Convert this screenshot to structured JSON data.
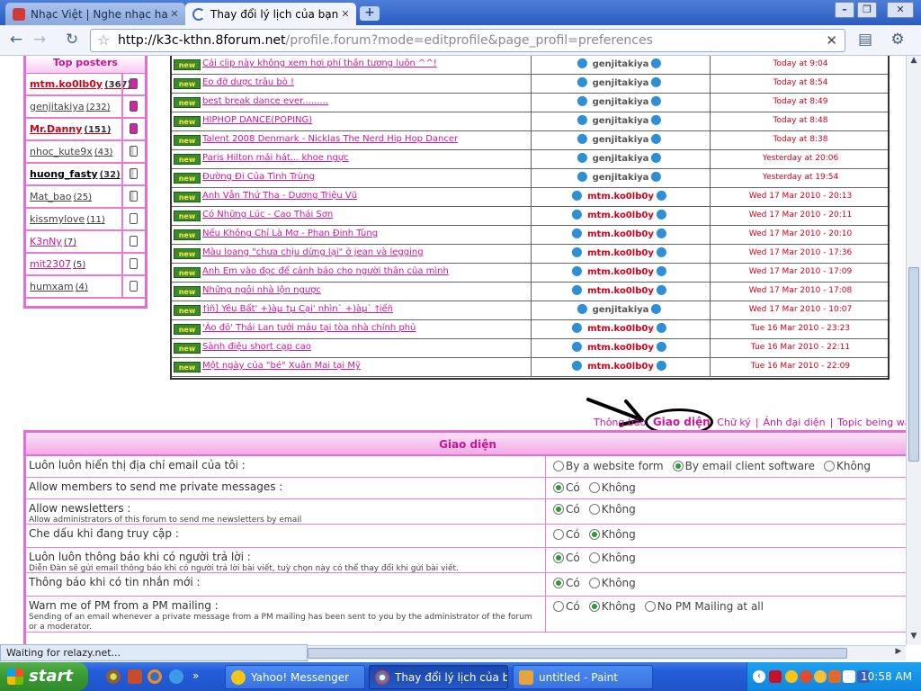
{
  "browser": {
    "tabs": [
      {
        "label": "Nhạc Việt | Nghe nhạc hay ...",
        "active": false
      },
      {
        "label": "Thay đổi lý lịch của bạn",
        "active": true
      }
    ],
    "url_host": "http://k3c-kthn.8forum.net",
    "url_path": "/profile.forum?mode=editprofile&page_profil=preferences",
    "status_text": "Waiting for relazy.net..."
  },
  "top_posters": {
    "title": "Top posters",
    "rows": [
      {
        "name": "mtm.ko0lb0y",
        "count": "(367)",
        "color": "#d4001a",
        "bold": true,
        "bar": "full"
      },
      {
        "name": "genjitakiya",
        "count": "(232)",
        "color": "#444444",
        "bold": false,
        "bar": "full"
      },
      {
        "name": "Mr.Danny",
        "count": "(151)",
        "color": "#d4001a",
        "bold": true,
        "bar": "full"
      },
      {
        "name": "nhoc_kute9x",
        "count": "(43)",
        "color": "#444444",
        "bold": false,
        "bar": "half"
      },
      {
        "name": "huong_fasty",
        "count": "(32)",
        "color": "#000000",
        "bold": true,
        "bar": "half"
      },
      {
        "name": "Mat_bao",
        "count": "(25)",
        "color": "#444444",
        "bold": false,
        "bar": "half"
      },
      {
        "name": "kissmylove",
        "count": "(11)",
        "color": "#444444",
        "bold": false,
        "bar": "empty"
      },
      {
        "name": "K3nNy",
        "count": "(7)",
        "color": "#d0169a",
        "bold": false,
        "bar": "empty"
      },
      {
        "name": "mit2307",
        "count": "(5)",
        "color": "#d0169a",
        "bold": false,
        "bar": "empty"
      },
      {
        "name": "humxam",
        "count": "(4)",
        "color": "#444444",
        "bold": false,
        "bar": "empty"
      }
    ]
  },
  "topics": [
    {
      "title": "Cái clip này không xem hơi phí thần tương luôn ^^!",
      "author": "genjitakiya",
      "author_style": "grey",
      "date": "Today at 9:04"
    },
    {
      "title": "Eo đỡ dược trâu bò !",
      "author": "genjitakiya",
      "author_style": "grey",
      "date": "Today at 8:54"
    },
    {
      "title": "best break dance ever.........",
      "author": "genjitakiya",
      "author_style": "grey",
      "date": "Today at 8:49"
    },
    {
      "title": "HIPHOP DANCE(POPING)",
      "author": "genjitakiya",
      "author_style": "grey",
      "date": "Today at 8:48"
    },
    {
      "title": "Talent 2008 Denmark - Nicklas The Nerd Hip Hop Dancer",
      "author": "genjitakiya",
      "author_style": "grey",
      "date": "Today at 8:38"
    },
    {
      "title": "Paris Hilton mải hát... khoe ngực",
      "author": "genjitakiya",
      "author_style": "grey",
      "date": "Yesterday at 20:06"
    },
    {
      "title": "Đường Đi Của Tình Trùng",
      "author": "genjitakiya",
      "author_style": "grey",
      "date": "Yesterday at 19:54"
    },
    {
      "title": "Anh Vẫn Thứ Tha - Dương Triệu Vũ",
      "author": "mtm.ko0lb0y",
      "author_style": "red",
      "date": "Wed 17 Mar 2010 - 20:13"
    },
    {
      "title": "Có Những Lúc - Cao Thái Sơn",
      "author": "mtm.ko0lb0y",
      "author_style": "red",
      "date": "Wed 17 Mar 2010 - 20:11"
    },
    {
      "title": "Nếu Không Chỉ Là Mơ - Phan Đinh Tùng",
      "author": "mtm.ko0lb0y",
      "author_style": "red",
      "date": "Wed 17 Mar 2010 - 20:10"
    },
    {
      "title": "Màu loang \"chưa chịu dừng lại\" ở jean và legging",
      "author": "mtm.ko0lb0y",
      "author_style": "red",
      "date": "Wed 17 Mar 2010 - 17:36"
    },
    {
      "title": "Anh Em vào đọc để cảnh báo cho người thân của mình",
      "author": "mtm.ko0lb0y",
      "author_style": "red",
      "date": "Wed 17 Mar 2010 - 17:09"
    },
    {
      "title": "Những ngôi nhà lộn ngược",
      "author": "mtm.ko0lb0y",
      "author_style": "red",
      "date": "Wed 17 Mar 2010 - 17:08"
    },
    {
      "title": "†ìñ] Yêu Bất' +)àµ †µ Cại' nhìn` +)àµ` †iếñ",
      "author": "genjitakiya",
      "author_style": "grey",
      "date": "Wed 17 Mar 2010 - 10:07"
    },
    {
      "title": "'Áo đỏ' Thái Lan tưới máu tại tòa nhà chính phủ",
      "author": "mtm.ko0lb0y",
      "author_style": "red",
      "date": "Tue 16 Mar 2010 - 23:23"
    },
    {
      "title": "Sành điệu short cạp cao",
      "author": "mtm.ko0lb0y",
      "author_style": "red",
      "date": "Tue 16 Mar 2010 - 22:11"
    },
    {
      "title": "Một ngày của \"bé\" Xuân Mai tại Mỹ",
      "author": "mtm.ko0lb0y",
      "author_style": "red",
      "date": "Tue 16 Mar 2010 - 22:09"
    }
  ],
  "new_badge": "new",
  "profile_tabs": {
    "thong_bao": "Thông báo",
    "giao_dien": "Giao diện",
    "chu_ky": "Chữ ký",
    "anh_dai_dien": "Ảnh đại diện",
    "topic_watched": "Topic being watched"
  },
  "prefs": {
    "title": "Giao diện",
    "rows": [
      {
        "label": "Luôn luôn hiển thị địa chỉ email của tôi :",
        "sub": "",
        "options": [
          "By a website form",
          "By email client software",
          "Không"
        ],
        "selected": 1
      },
      {
        "label": "Allow members to send me private messages :",
        "sub": "",
        "options": [
          "Có",
          "Không"
        ],
        "selected": 0
      },
      {
        "label": "Allow newsletters :",
        "sub": "Allow administrators of this forum to send me newsletters by email",
        "options": [
          "Có",
          "Không"
        ],
        "selected": 0
      },
      {
        "label": "Che dấu khi đang truy cập :",
        "sub": "",
        "options": [
          "Có",
          "Không"
        ],
        "selected": 1
      },
      {
        "label": "Luôn luôn thông báo khi có người trả lời :",
        "sub": "Diễn Đàn sẽ gửi email thông báo khi có người trả lời bài viết, tuỳ chọn này có thể thay đổi khi gửi bài viết.",
        "options": [
          "Có",
          "Không"
        ],
        "selected": 0
      },
      {
        "label": "Thông báo khi có tin nhắn mới :",
        "sub": "",
        "options": [
          "Có",
          "Không"
        ],
        "selected": 0
      },
      {
        "label": "Warn me of PM from a PM mailing :",
        "sub": "Sending of an email whenever a private message from a PM mailing has been sent to you by the administrator of the forum or a moderator.",
        "options": [
          "Có",
          "Không",
          "No PM Mailing at all"
        ],
        "selected": 1
      }
    ]
  },
  "taskbar": {
    "start": "start",
    "tasks": [
      {
        "label": "Yahoo! Messenger",
        "active": false,
        "icon_color": "#f5c518"
      },
      {
        "label": "Thay đổi lý lịch của b...",
        "active": true,
        "icon_color": "#3a8ee6"
      },
      {
        "label": "untitled - Paint",
        "active": false,
        "icon_color": "#e9a33d"
      }
    ],
    "clock": "10:58 AM"
  }
}
